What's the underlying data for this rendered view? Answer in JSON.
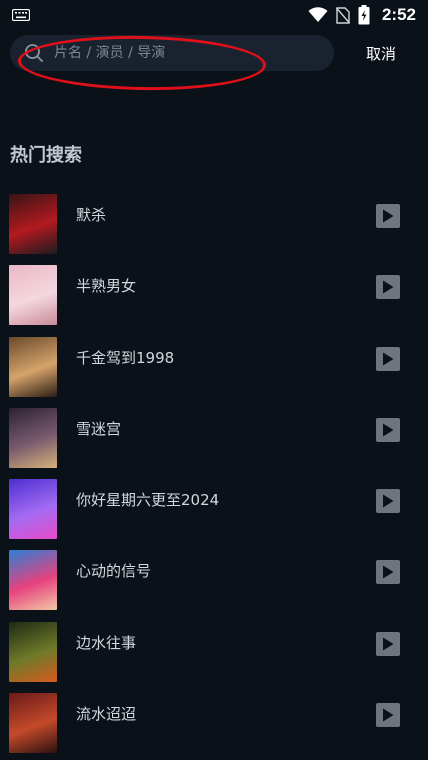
{
  "status_bar": {
    "time": "2:52",
    "icons": [
      "keyboard-icon",
      "wifi-icon",
      "no-sim-icon",
      "battery-charging-icon"
    ]
  },
  "search": {
    "placeholder": "片名 / 演员 / 导演",
    "value": "",
    "cancel_label": "取消"
  },
  "hot_search": {
    "title": "热门搜索",
    "items": [
      {
        "title": "默杀",
        "poster_colors": [
          "#3a1416",
          "#b21a1f",
          "#1b1b1f"
        ]
      },
      {
        "title": "半熟男女",
        "poster_colors": [
          "#e9b7c5",
          "#f4d7df",
          "#c98a9a"
        ]
      },
      {
        "title": "千金驾到1998",
        "poster_colors": [
          "#6a4a2c",
          "#d6a36b",
          "#2a1c14"
        ]
      },
      {
        "title": "雪迷宫",
        "poster_colors": [
          "#2b2232",
          "#7a5b6e",
          "#d6b27a"
        ]
      },
      {
        "title": "你好星期六更至2024",
        "poster_colors": [
          "#4b2fd1",
          "#a46bf2",
          "#e84ac8"
        ]
      },
      {
        "title": "心动的信号",
        "poster_colors": [
          "#2b7fd4",
          "#e7427e",
          "#f1c8a4"
        ]
      },
      {
        "title": "边水往事",
        "poster_colors": [
          "#1f2b12",
          "#6f7a2a",
          "#d65a1e"
        ]
      },
      {
        "title": "流水迢迢",
        "poster_colors": [
          "#6a1a1a",
          "#c44a2a",
          "#2b1010"
        ]
      }
    ]
  }
}
